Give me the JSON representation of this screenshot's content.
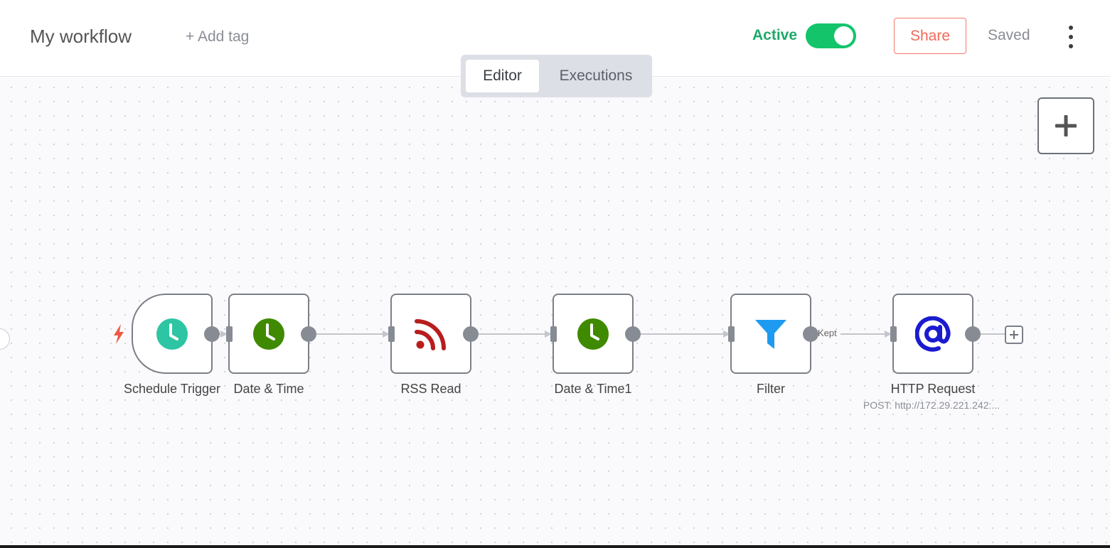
{
  "header": {
    "title": "My workflow",
    "add_tag": "+ Add tag",
    "active_label": "Active",
    "active": true,
    "share": "Share",
    "status": "Saved"
  },
  "tabs": [
    {
      "label": "Editor",
      "selected": true
    },
    {
      "label": "Executions",
      "selected": false
    }
  ],
  "colors": {
    "accent": "#13c46b",
    "share": "#f06a5a",
    "schedule_icon": "#2dc5a3",
    "datetime_icon": "#3f8a00",
    "rss_icon": "#b81d1d",
    "filter_icon": "#1e9bf0",
    "http_icon": "#1b1bd0",
    "trigger_bolt": "#ef5a45"
  },
  "nodes": [
    {
      "name": "Schedule Trigger",
      "icon": "clock-icon",
      "trigger": true
    },
    {
      "name": "Date & Time",
      "icon": "clock-icon"
    },
    {
      "name": "RSS Read",
      "icon": "rss-icon"
    },
    {
      "name": "Date & Time1",
      "icon": "clock-icon"
    },
    {
      "name": "Filter",
      "icon": "filter-icon"
    },
    {
      "name": "HTTP Request",
      "icon": "at-sign-icon",
      "subtitle": "POST: http://172.29.221.242:..."
    }
  ],
  "connections": {
    "filter_output_label": "Kept"
  }
}
